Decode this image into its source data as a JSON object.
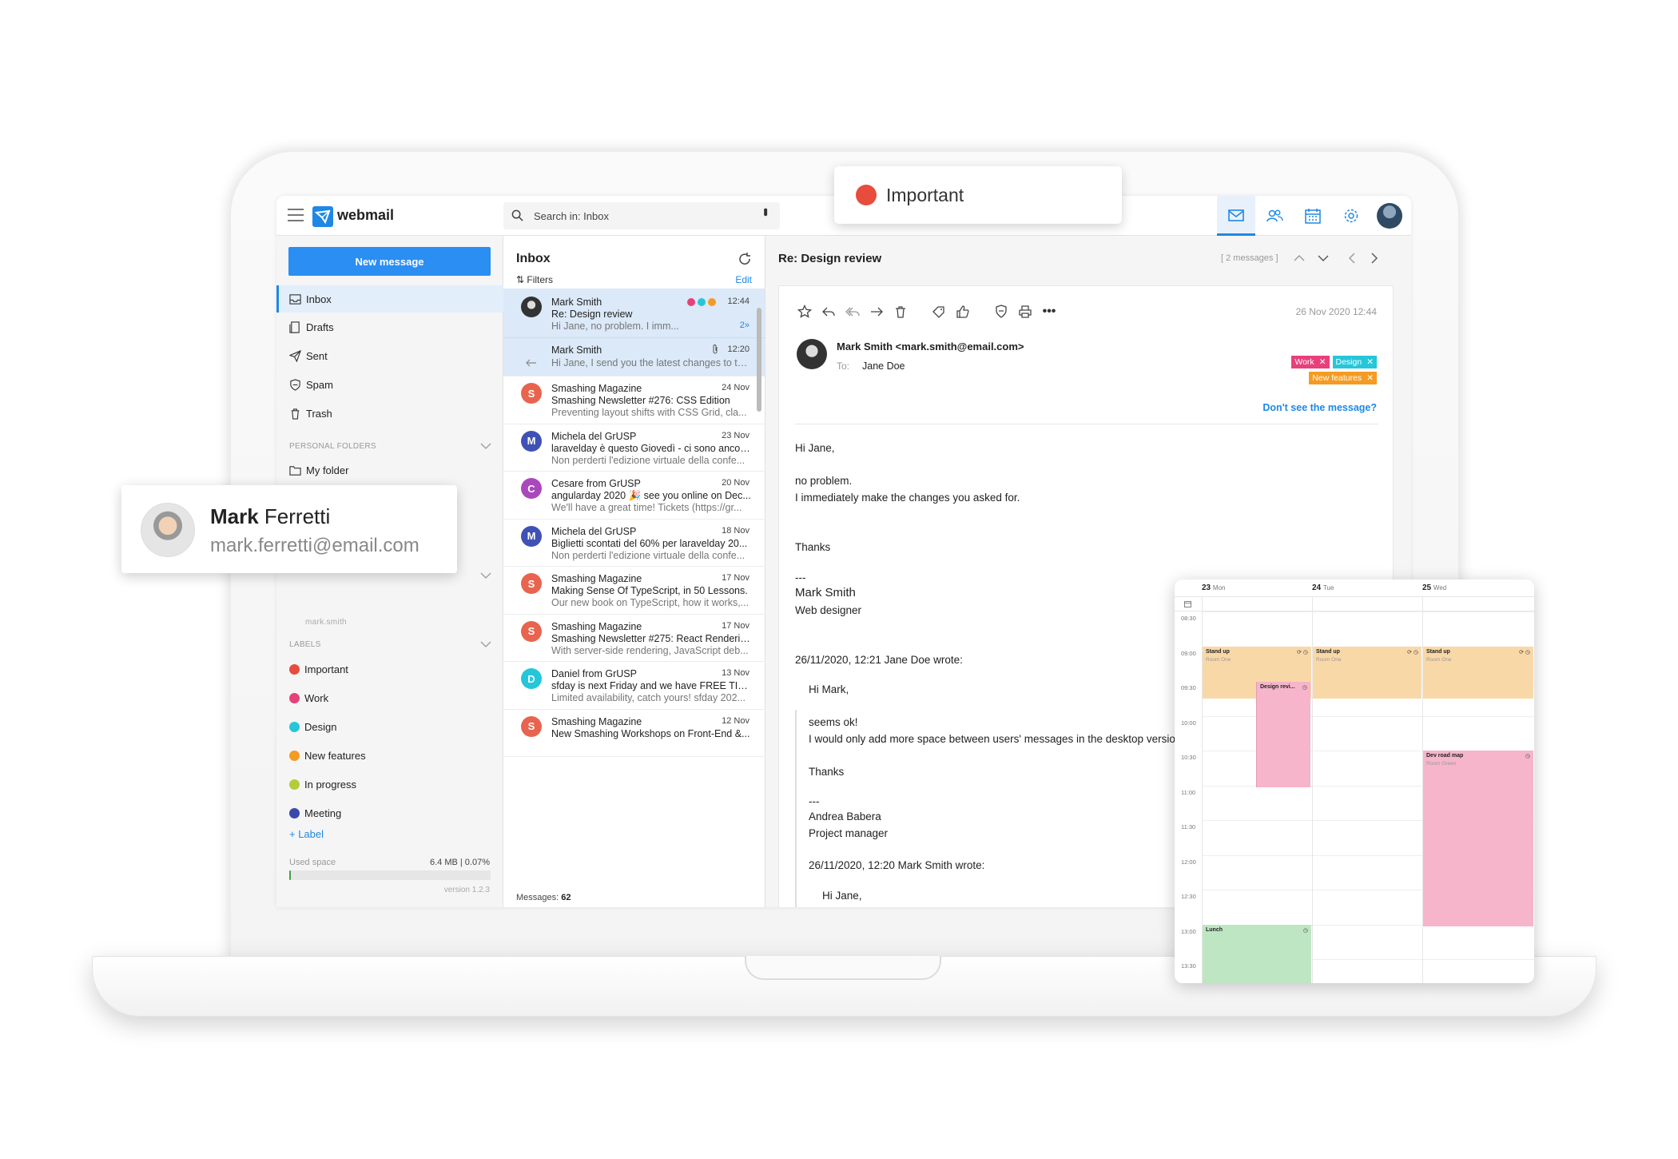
{
  "app": {
    "name": "webmail"
  },
  "search": {
    "placeholder": "Search in: Inbox"
  },
  "sidebar": {
    "new_message": "New message",
    "folders": [
      {
        "label": "Inbox",
        "icon": "inbox-icon"
      },
      {
        "label": "Drafts",
        "icon": "drafts-icon"
      },
      {
        "label": "Sent",
        "icon": "sent-icon"
      },
      {
        "label": "Spam",
        "icon": "spam-icon"
      },
      {
        "label": "Trash",
        "icon": "trash-icon"
      }
    ],
    "personal_folders_title": "PERSONAL FOLDERS",
    "my_folder": "My folder",
    "account_user": "mark.smith",
    "labels_title": "LABELS",
    "labels": [
      {
        "label": "Important",
        "color": "#e74c3c"
      },
      {
        "label": "Work",
        "color": "#e8407a"
      },
      {
        "label": "Design",
        "color": "#26c6da"
      },
      {
        "label": "New features",
        "color": "#f59b23"
      },
      {
        "label": "In progress",
        "color": "#b5cc3a"
      },
      {
        "label": "Meeting",
        "color": "#3949ab"
      }
    ],
    "add_label": "+ Label",
    "used_space_label": "Used space",
    "used_space_value": "6.4 MB | 0.07%",
    "used_space_fraction": 0.0007,
    "version": "version 1.2.3"
  },
  "list": {
    "title": "Inbox",
    "filters": "⇅ Filters",
    "edit": "Edit",
    "messages": [
      {
        "from": "Mark Smith",
        "date": "12:44",
        "subject": "Re: Design review",
        "preview": "Hi Jane, no problem. I imm...",
        "thread": "2»",
        "avatar": "",
        "avatar_color": "#333333"
      },
      {
        "from": "Mark Smith",
        "date": "12:20",
        "subject": "",
        "preview": "Hi Jane, I send you the latest changes to th...",
        "avatar": "",
        "avatar_color": ""
      },
      {
        "from": "Smashing Magazine",
        "date": "24 Nov",
        "subject": "Smashing Newsletter #276: CSS Edition",
        "preview": "Preventing layout shifts with CSS Grid, cla...",
        "avatar": "S",
        "avatar_color": "#e8644e"
      },
      {
        "from": "Michela del GrUSP",
        "date": "23 Nov",
        "subject": "laravelday è questo Giovedì - ci sono ancor...",
        "preview": "Non perderti l'edizione virtuale della confe...",
        "avatar": "M",
        "avatar_color": "#3f51b5"
      },
      {
        "from": "Cesare from GrUSP",
        "date": "20 Nov",
        "subject": "angularday 2020 🎉 see you online on Dec...",
        "preview": "We'll have a great time! Tickets (https://gr...",
        "avatar": "C",
        "avatar_color": "#ab47bc"
      },
      {
        "from": "Michela del GrUSP",
        "date": "18 Nov",
        "subject": "Biglietti scontati del 60% per laravelday 20...",
        "preview": "Non perderti l'edizione virtuale della confe...",
        "avatar": "M",
        "avatar_color": "#3f51b5"
      },
      {
        "from": "Smashing Magazine",
        "date": "17 Nov",
        "subject": "Making Sense Of TypeScript, in 50 Lessons.",
        "preview": "Our new book on TypeScript, how it works,...",
        "avatar": "S",
        "avatar_color": "#e8644e"
      },
      {
        "from": "Smashing Magazine",
        "date": "17 Nov",
        "subject": "Smashing Newsletter #275: React Renderin...",
        "preview": "With server-side rendering, JavaScript deb...",
        "avatar": "S",
        "avatar_color": "#e8644e"
      },
      {
        "from": "Daniel from GrUSP",
        "date": "13 Nov",
        "subject": "sfday is next Friday and we have FREE TICK...",
        "preview": "Limited availability, catch yours! sfday 202...",
        "avatar": "D",
        "avatar_color": "#26c6da"
      },
      {
        "from": "Smashing Magazine",
        "date": "12 Nov",
        "subject": "New Smashing Workshops on Front-End &...",
        "preview": "",
        "avatar": "S",
        "avatar_color": "#e8644e"
      }
    ],
    "count_label": "Messages:",
    "count": "62"
  },
  "reader": {
    "subject": "Re: Design review",
    "thread_count": "[ 2 messages ]",
    "date": "26 Nov 2020 12:44",
    "from": "Mark Smith <mark.smith@email.com>",
    "to_label": "To:",
    "to": "Jane Doe",
    "tags": [
      {
        "label": "Work",
        "color": "#e8407a"
      },
      {
        "label": "Design",
        "color": "#26c6da"
      },
      {
        "label": "New features",
        "color": "#f59b23"
      }
    ],
    "dont_see": "Don't see the message?",
    "body": {
      "greeting": "Hi Jane,",
      "line1": "no problem.",
      "line2": "I immediately make the changes you asked for.",
      "thanks": "Thanks",
      "sep": "---",
      "sig_name": "Mark Smith",
      "sig_role": "Web designer",
      "quote_header": "26/11/2020, 12:21 Jane Doe wrote:",
      "q_greeting": "Hi Mark,",
      "q_line1": "seems ok!",
      "q_line2": "I would only add more space between users' messages in the desktop version.",
      "q_thanks": "Thanks",
      "q_sep": "---",
      "q_name": "Andrea Babera",
      "q_role": "Project manager",
      "q2_header": "26/11/2020, 12:20 Mark Smith  wrote:",
      "q2_greeting": "Hi Jane,"
    }
  },
  "important_popup": {
    "label": "Important",
    "color": "#e74c3c"
  },
  "contact_popup": {
    "first": "Mark",
    "last": " Ferretti",
    "email": "mark.ferretti@email.com"
  },
  "calendar": {
    "days": [
      {
        "num": "23",
        "name": "Mon"
      },
      {
        "num": "24",
        "name": "Tue"
      },
      {
        "num": "25",
        "name": "Wed"
      }
    ],
    "times": [
      "08:30",
      "09:00",
      "09:30",
      "10:00",
      "10:30",
      "11:00",
      "11:30",
      "12:00",
      "12:30",
      "13:00",
      "13:30"
    ],
    "events": [
      {
        "title": "Stand up",
        "room": "Room One",
        "color": "#f9d8a8"
      },
      {
        "title": "Stand up",
        "room": "Room One",
        "color": "#f9d8a8"
      },
      {
        "title": "Stand up",
        "room": "Room One",
        "color": "#f9d8a8"
      },
      {
        "title": "Design revi...",
        "room": "",
        "color": "#f6b5ca"
      },
      {
        "title": "Dev road map",
        "room": "Room Green",
        "color": "#f6b5ca"
      },
      {
        "title": "Lunch",
        "room": "",
        "color": "#bfe6c3"
      }
    ]
  }
}
